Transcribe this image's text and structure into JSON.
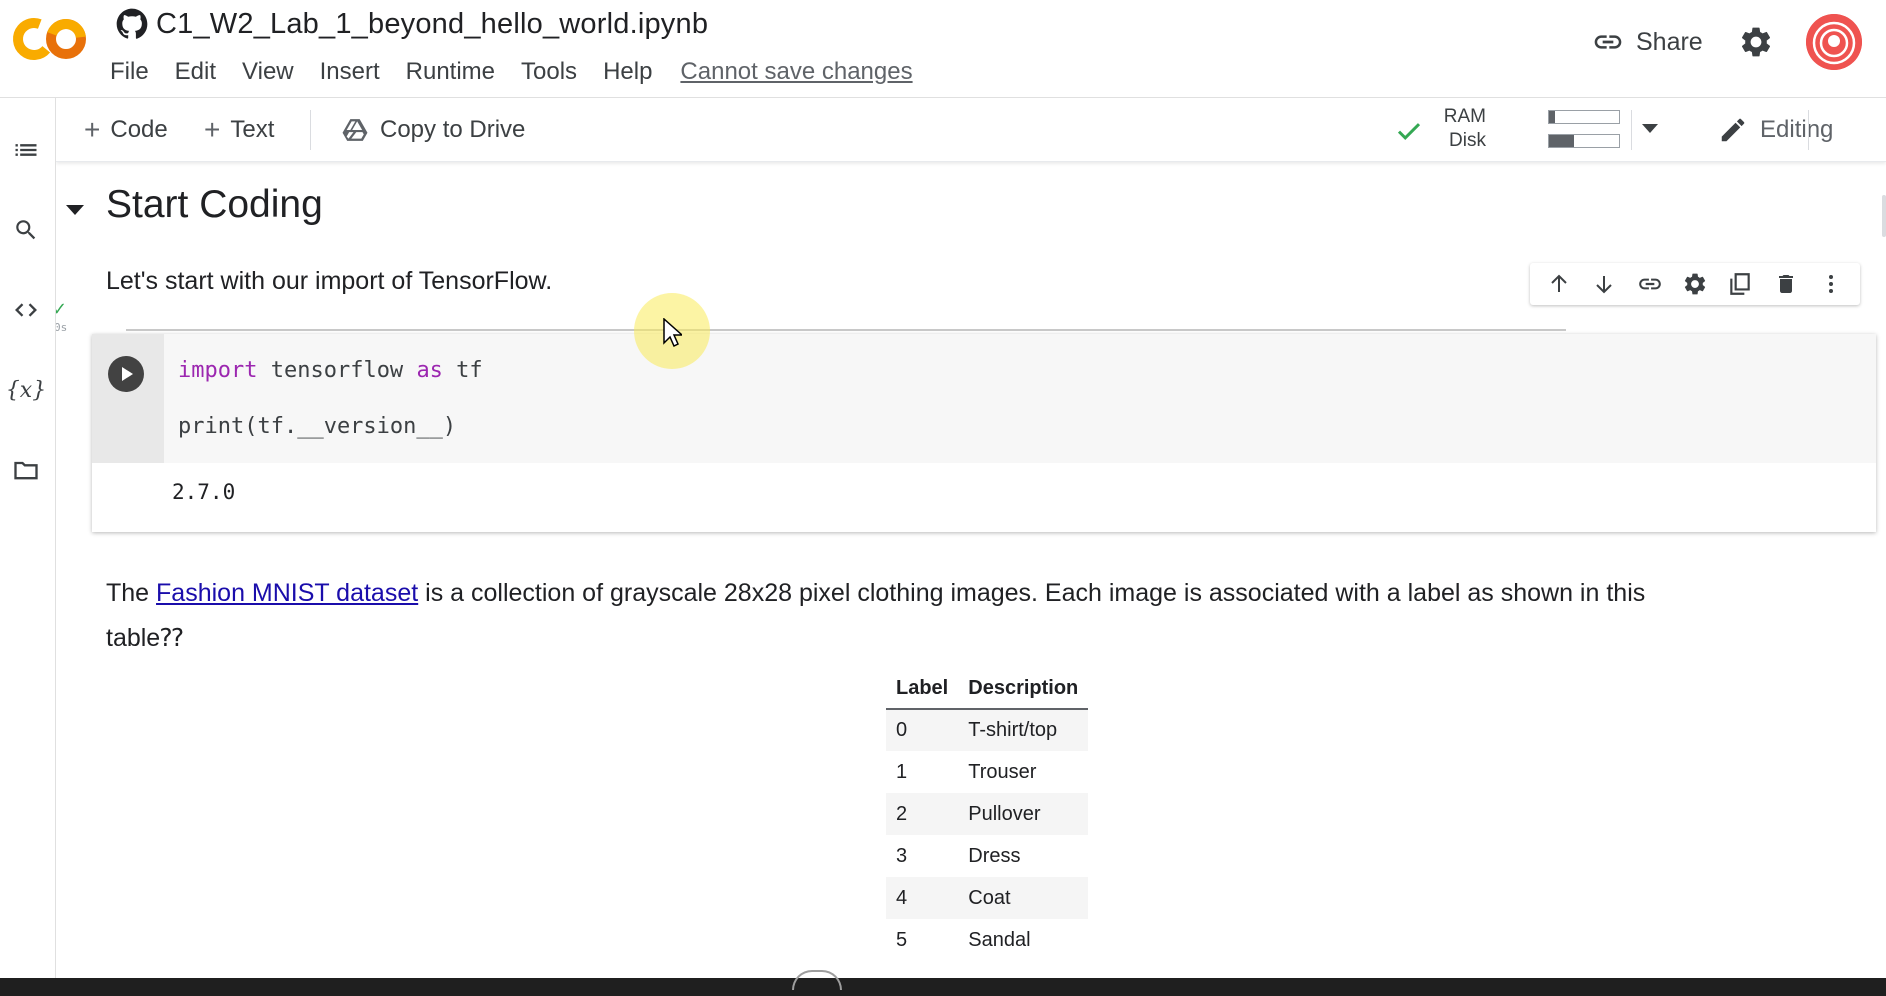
{
  "header": {
    "notebook_title": "C1_W2_Lab_1_beyond_hello_world.ipynb",
    "menu": [
      "File",
      "Edit",
      "View",
      "Insert",
      "Runtime",
      "Tools",
      "Help"
    ],
    "save_warning": "Cannot save changes",
    "share_label": "Share",
    "logo_text": "CO"
  },
  "toolbar": {
    "code_label": "Code",
    "text_label": "Text",
    "copy_to_drive_label": "Copy to Drive",
    "ram_label": "RAM",
    "disk_label": "Disk",
    "ram_usage": 0.08,
    "disk_usage": 0.35,
    "editing_label": "Editing"
  },
  "notebook": {
    "section_title": "Start Coding",
    "intro_text": "Let's start with our import of TensorFlow.",
    "code_cell": {
      "line1": {
        "kw1": "import",
        "t1": " tensorflow ",
        "kw2": "as",
        "t2": " tf"
      },
      "line2": "print(tf.__version__)",
      "output": "2.7.0",
      "exec_time": "0s"
    },
    "fashion_paragraph": {
      "before": "The ",
      "link": "Fashion MNIST dataset",
      "after": " is a collection of grayscale 28x28 pixel clothing images. Each image is associated with a label as shown in this",
      "line2": "table⁇"
    },
    "label_table": {
      "headers": [
        "Label",
        "Description"
      ],
      "rows": [
        [
          "0",
          "T-shirt/top"
        ],
        [
          "1",
          "Trouser"
        ],
        [
          "2",
          "Pullover"
        ],
        [
          "3",
          "Dress"
        ],
        [
          "4",
          "Coat"
        ],
        [
          "5",
          "Sandal"
        ]
      ]
    }
  },
  "colors": {
    "logo_orange": "#f9ab00",
    "logo_dark": "#e8710a",
    "link": "#1a0dab",
    "keyword": "#9c27b0",
    "check_green": "#34a853"
  },
  "icons": {
    "sidebar": [
      "toc-icon",
      "search-icon",
      "code-snippets-icon",
      "variables-icon",
      "files-icon"
    ],
    "cell_toolbar": [
      "move-up-icon",
      "move-down-icon",
      "link-icon",
      "gear-icon",
      "mirror-cell-icon",
      "delete-icon",
      "more-vert-icon"
    ]
  }
}
